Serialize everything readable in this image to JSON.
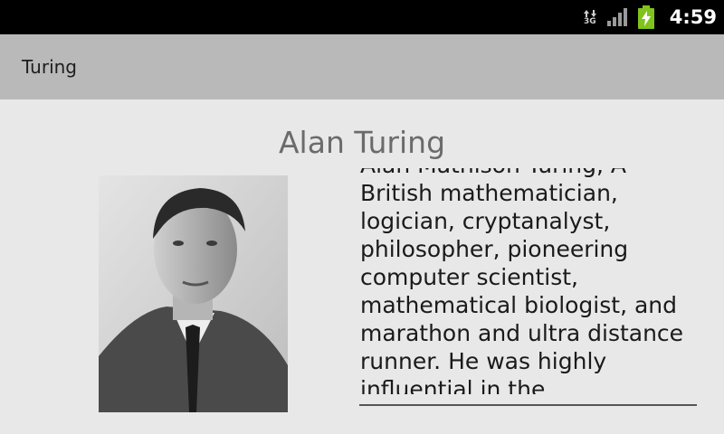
{
  "status_bar": {
    "network_type": "3G",
    "time": "4:59",
    "icons": [
      "data-arrows-icon",
      "signal-strength-icon",
      "battery-charging-icon"
    ],
    "battery_color": "#7fc31c"
  },
  "app_bar": {
    "title": "Turing"
  },
  "profile": {
    "name": "Alan Turing",
    "portrait_icon": "portrait-photo",
    "bio": "Alan Mathison Turing, A British mathematician, logician, cryptanalyst, philosopher, pioneering computer scientist, mathematical biologist, and marathon and ultra distance runner. He was highly influential in the development"
  },
  "colors": {
    "background": "#e8e8e8",
    "title_bar": "#b9b9b9",
    "status_bar": "#000000",
    "heading_text": "#6b6b6b"
  }
}
